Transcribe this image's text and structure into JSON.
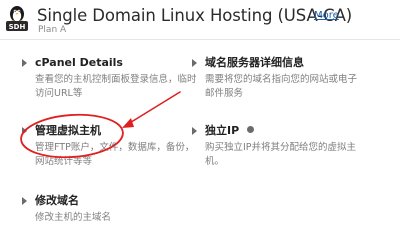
{
  "header": {
    "logo_text": "SDH",
    "title": "Single Domain Linux Hosting (USA-CA)",
    "more_label": "More",
    "subtitle": "Plan A"
  },
  "features": [
    {
      "title": "cPanel Details",
      "desc": "查看您的主机控制面板登录信息，临时访问URL等"
    },
    {
      "title": "域名服务器详细信息",
      "desc": "需要将您的域名指向您的网站或电子邮件服务"
    },
    {
      "title": "管理虚拟主机",
      "desc": "管理FTP账户，文件，数据库，备份，网站统计等等"
    },
    {
      "title": "独立IP",
      "desc": "购买独立IP并将其分配给您的虚拟主机。"
    },
    {
      "title": "修改域名",
      "desc": "修改主机的主域名"
    }
  ],
  "colors": {
    "annotation": "#e02020",
    "link": "#1f5fb0"
  }
}
